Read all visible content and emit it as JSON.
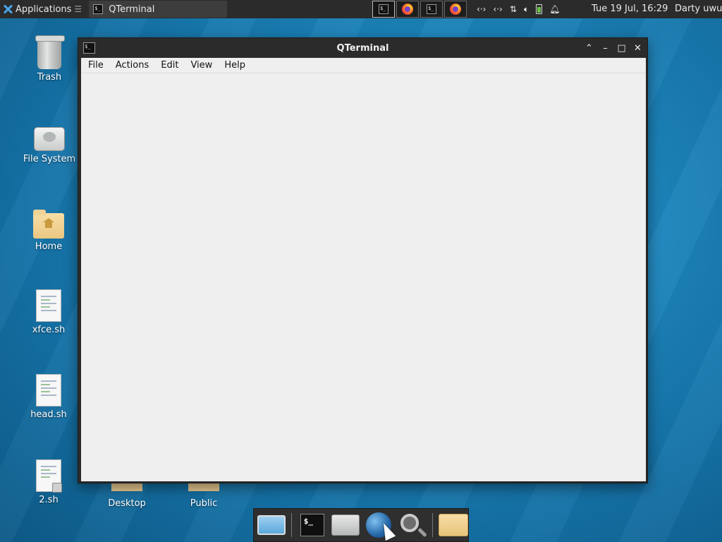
{
  "panel": {
    "applications_label": "Applications",
    "task_title": "QTerminal",
    "clock": "Tue 19 Jul, 16:29",
    "user": "Darty uwu",
    "tray_apps": [
      "terminal-icon",
      "firefox-icon",
      "terminal-icon",
      "firefox-icon"
    ],
    "status_icons": [
      "network-icon",
      "network-icon",
      "transfer-icon",
      "volume-icon",
      "battery-icon",
      "notification-bell-icon"
    ]
  },
  "desktop": {
    "icons": [
      {
        "label": "Trash",
        "icon": "trash-icon"
      },
      {
        "label": "File System",
        "icon": "hard-drive-icon"
      },
      {
        "label": "Home",
        "icon": "home-folder-icon"
      },
      {
        "label": "xfce.sh",
        "icon": "script-file-icon"
      },
      {
        "label": "head.sh",
        "icon": "script-file-icon"
      },
      {
        "label": "2.sh",
        "icon": "locked-script-file-icon"
      },
      {
        "label": "Desktop",
        "icon": "folder-icon"
      },
      {
        "label": "Public",
        "icon": "folder-icon"
      }
    ]
  },
  "window": {
    "title": "QTerminal",
    "menu": [
      "File",
      "Actions",
      "Edit",
      "View",
      "Help"
    ],
    "controls": [
      "shade-up-icon",
      "minimize-icon",
      "maximize-icon",
      "close-icon"
    ]
  },
  "dock": {
    "items": [
      "show-desktop-icon",
      "terminal-icon",
      "home-folder-icon",
      "web-browser-icon",
      "search-icon",
      "folder-icon"
    ]
  },
  "colors": {
    "panel_bg": "#2b2b2b",
    "desktop_blue": "#1d86bd",
    "window_frame": "#2b2b2b",
    "terminal_bg": "#efefef"
  }
}
